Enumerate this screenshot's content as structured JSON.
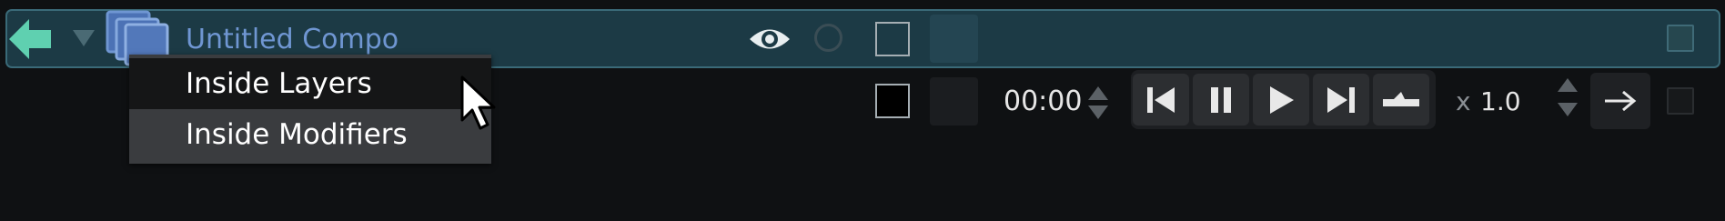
{
  "composition": {
    "name": "Untitled Compo",
    "accent_color": "#5fd0b0",
    "bar_color": "#1c3a45"
  },
  "icons": {
    "back": "left-arrow-icon",
    "collapse": "chevron-down-icon",
    "stack": "layer-stack-icon",
    "eye": "eye-icon",
    "circle": "circle-icon"
  },
  "context_menu": {
    "items": [
      {
        "label": "Inside Layers",
        "highlighted": true
      },
      {
        "label": "Inside Modifiers",
        "highlighted": false
      }
    ]
  },
  "transport": {
    "time": "00:00",
    "speed_prefix": "x",
    "speed": "1.0",
    "buttons": [
      "skip-back-icon",
      "pause-icon",
      "play-icon",
      "skip-forward-icon",
      "bounce-icon"
    ]
  }
}
